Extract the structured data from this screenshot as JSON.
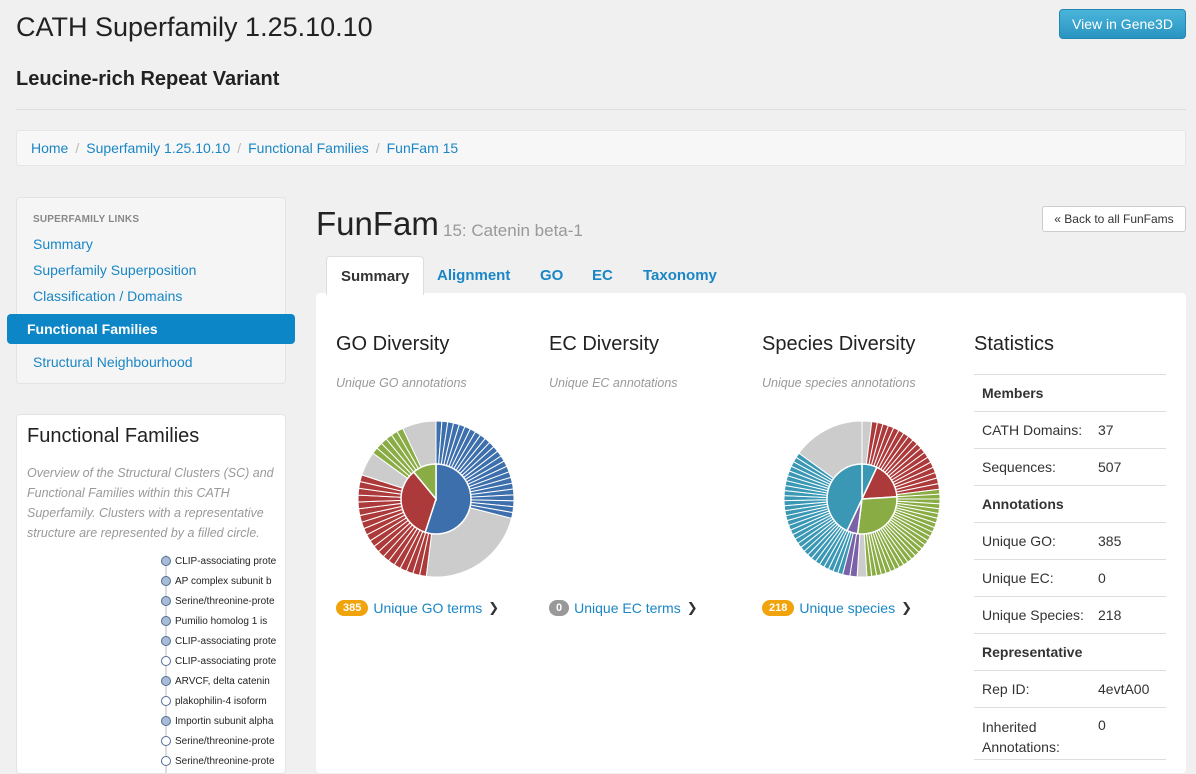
{
  "header": {
    "title": "CATH Superfamily 1.25.10.10",
    "subtitle": "Leucine-rich Repeat Variant",
    "gene3d_button": "View in Gene3D"
  },
  "breadcrumb": [
    "Home",
    "Superfamily 1.25.10.10",
    "Functional Families",
    "FunFam 15"
  ],
  "sidebar": {
    "heading": "SUPERFAMILY LINKS",
    "links": [
      "Summary",
      "Superfamily Superposition",
      "Classification / Domains",
      "Functional Families",
      "Structural Neighbourhood"
    ]
  },
  "ff_panel": {
    "title": "Functional Families",
    "description": "Overview of the Structural Clusters (SC) and Functional Families within this CATH Superfamily. Clusters with a representative structure are represented by a filled circle.",
    "items": [
      {
        "label": "CLIP-associating prote",
        "filled": true
      },
      {
        "label": "AP complex subunit b",
        "filled": true
      },
      {
        "label": "Serine/threonine-prote",
        "filled": true
      },
      {
        "label": "Pumilio homolog 1 is",
        "filled": true
      },
      {
        "label": "CLIP-associating prote",
        "filled": true
      },
      {
        "label": "CLIP-associating prote",
        "filled": false
      },
      {
        "label": "ARVCF, delta catenin",
        "filled": true
      },
      {
        "label": "plakophilin-4 isoform",
        "filled": false
      },
      {
        "label": "Importin subunit alpha",
        "filled": true
      },
      {
        "label": "Serine/threonine-prote",
        "filled": false
      },
      {
        "label": "Serine/threonine-prote",
        "filled": false
      }
    ]
  },
  "funfam": {
    "title": "FunFam",
    "subtitle": "15: Catenin beta-1",
    "back_button": "« Back to all FunFams"
  },
  "tabs": [
    "Summary",
    "Alignment",
    "GO",
    "EC",
    "Taxonomy"
  ],
  "columns": [
    {
      "title": "GO Diversity",
      "subtitle": "Unique GO annotations",
      "count": "385",
      "link": "Unique GO terms",
      "badge_color": "#f0a30a"
    },
    {
      "title": "EC Diversity",
      "subtitle": "Unique EC annotations",
      "count": "0",
      "link": "Unique EC terms",
      "badge_color": "#999999"
    },
    {
      "title": "Species Diversity",
      "subtitle": "Unique species annotations",
      "count": "218",
      "link": "Unique species",
      "badge_color": "#f0a30a"
    }
  ],
  "statistics": {
    "title": "Statistics",
    "rows": [
      {
        "k": "Members",
        "v": "",
        "head": true
      },
      {
        "k": "CATH Domains:",
        "v": "37"
      },
      {
        "k": "Sequences:",
        "v": "507"
      },
      {
        "k": "Annotations",
        "v": "",
        "head": true
      },
      {
        "k": "Unique GO:",
        "v": "385"
      },
      {
        "k": "Unique EC:",
        "v": "0"
      },
      {
        "k": "Unique Species:",
        "v": "218"
      },
      {
        "k": "Representative",
        "v": "",
        "head": true
      },
      {
        "k": "Rep ID:",
        "v": "4evtA00"
      },
      {
        "k": "Inherited Annotations:",
        "v": "0",
        "tall": true
      }
    ]
  },
  "colors": {
    "blue": "#3d6fad",
    "red": "#ad3a3a",
    "green": "#8aac45",
    "grey": "#cccccc",
    "teal": "#3a98b5",
    "purple": "#7a62a8"
  },
  "sunbursts": {
    "go": {
      "inner": [
        {
          "color": "blue",
          "fraction": 0.55
        },
        {
          "color": "red",
          "fraction": 0.34
        },
        {
          "color": "green",
          "fraction": 0.11
        }
      ],
      "outer": [
        {
          "color": "blue",
          "count": 24,
          "fraction": 0.29
        },
        {
          "color": "grey",
          "count": 1,
          "fraction": 0.23
        },
        {
          "color": "red",
          "count": 20,
          "fraction": 0.28
        },
        {
          "color": "grey",
          "count": 1,
          "fraction": 0.05
        },
        {
          "color": "green",
          "count": 6,
          "fraction": 0.08
        },
        {
          "color": "grey",
          "count": 1,
          "fraction": 0.07
        }
      ]
    },
    "species": {
      "inner": [
        {
          "color": "teal",
          "fraction": 0.07
        },
        {
          "color": "red",
          "fraction": 0.17
        },
        {
          "color": "green",
          "fraction": 0.28
        },
        {
          "color": "purple",
          "fraction": 0.05
        },
        {
          "color": "teal",
          "fraction": 0.43
        }
      ],
      "outer": [
        {
          "color": "grey",
          "count": 1,
          "fraction": 0.02
        },
        {
          "color": "red",
          "count": 18,
          "fraction": 0.21
        },
        {
          "color": "green",
          "count": 26,
          "fraction": 0.26
        },
        {
          "color": "grey",
          "count": 1,
          "fraction": 0.02
        },
        {
          "color": "purple",
          "count": 2,
          "fraction": 0.03
        },
        {
          "color": "teal",
          "count": 30,
          "fraction": 0.31
        },
        {
          "color": "grey",
          "count": 1,
          "fraction": 0.15
        }
      ]
    }
  }
}
